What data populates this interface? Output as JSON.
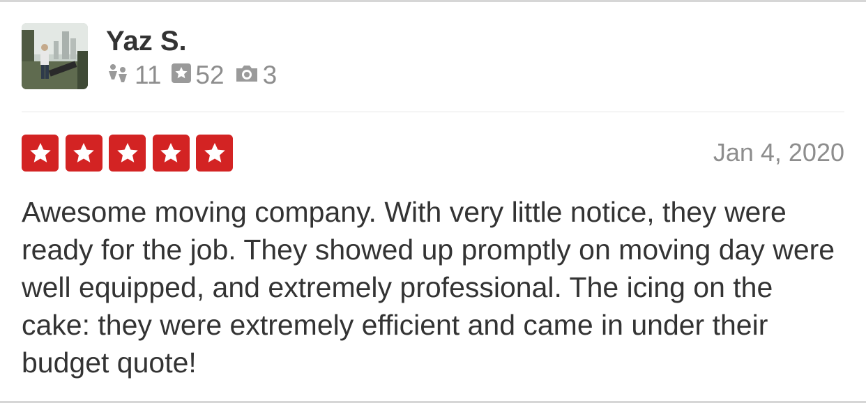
{
  "review": {
    "user": {
      "name": "Yaz S.",
      "avatar_icon": "user-avatar-photo",
      "friends_count": "11",
      "reviews_count": "52",
      "photos_count": "3"
    },
    "rating": {
      "stars": 5,
      "max_stars": 5,
      "color": "#d32323"
    },
    "date": "Jan 4, 2020",
    "text": "Awesome moving company. With very little notice, they were ready for the job. They showed up promptly on moving day were well equipped, and extremely professional. The icing on the cake: they were extremely efficient and came in under their budget quote!"
  },
  "icons": {
    "friends": "friends-icon",
    "reviews": "star-badge-icon",
    "photos": "camera-icon"
  }
}
